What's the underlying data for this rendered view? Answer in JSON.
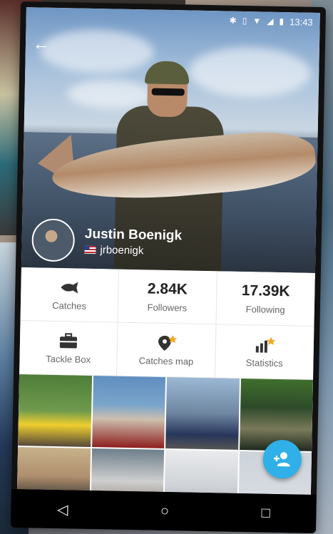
{
  "status_bar": {
    "time": "13:43",
    "icons": [
      "bluetooth-icon",
      "vibrate-icon",
      "wifi-icon",
      "signal-icon",
      "battery-icon"
    ]
  },
  "header": {
    "back_icon": "arrow-left-icon"
  },
  "profile": {
    "name": "Justin Boenigk",
    "username": "jrboenigk",
    "flag": "us-flag-icon"
  },
  "stats": [
    {
      "icon": "fish-icon",
      "label": "Catches",
      "value": ""
    },
    {
      "icon": "",
      "label": "Followers",
      "value": "2.84K"
    },
    {
      "icon": "",
      "label": "Following",
      "value": "17.39K"
    },
    {
      "icon": "tackle-box-icon",
      "label": "Tackle Box",
      "value": ""
    },
    {
      "icon": "map-pin-icon",
      "label": "Catches map",
      "value": ""
    },
    {
      "icon": "bar-chart-icon",
      "label": "Statistics",
      "value": ""
    }
  ],
  "badges": {
    "color": "#f5a623"
  },
  "fab": {
    "icon": "add-person-icon",
    "color": "#2fb0e8"
  },
  "navbar": {
    "back": "◁",
    "home": "○",
    "recents": "□"
  }
}
